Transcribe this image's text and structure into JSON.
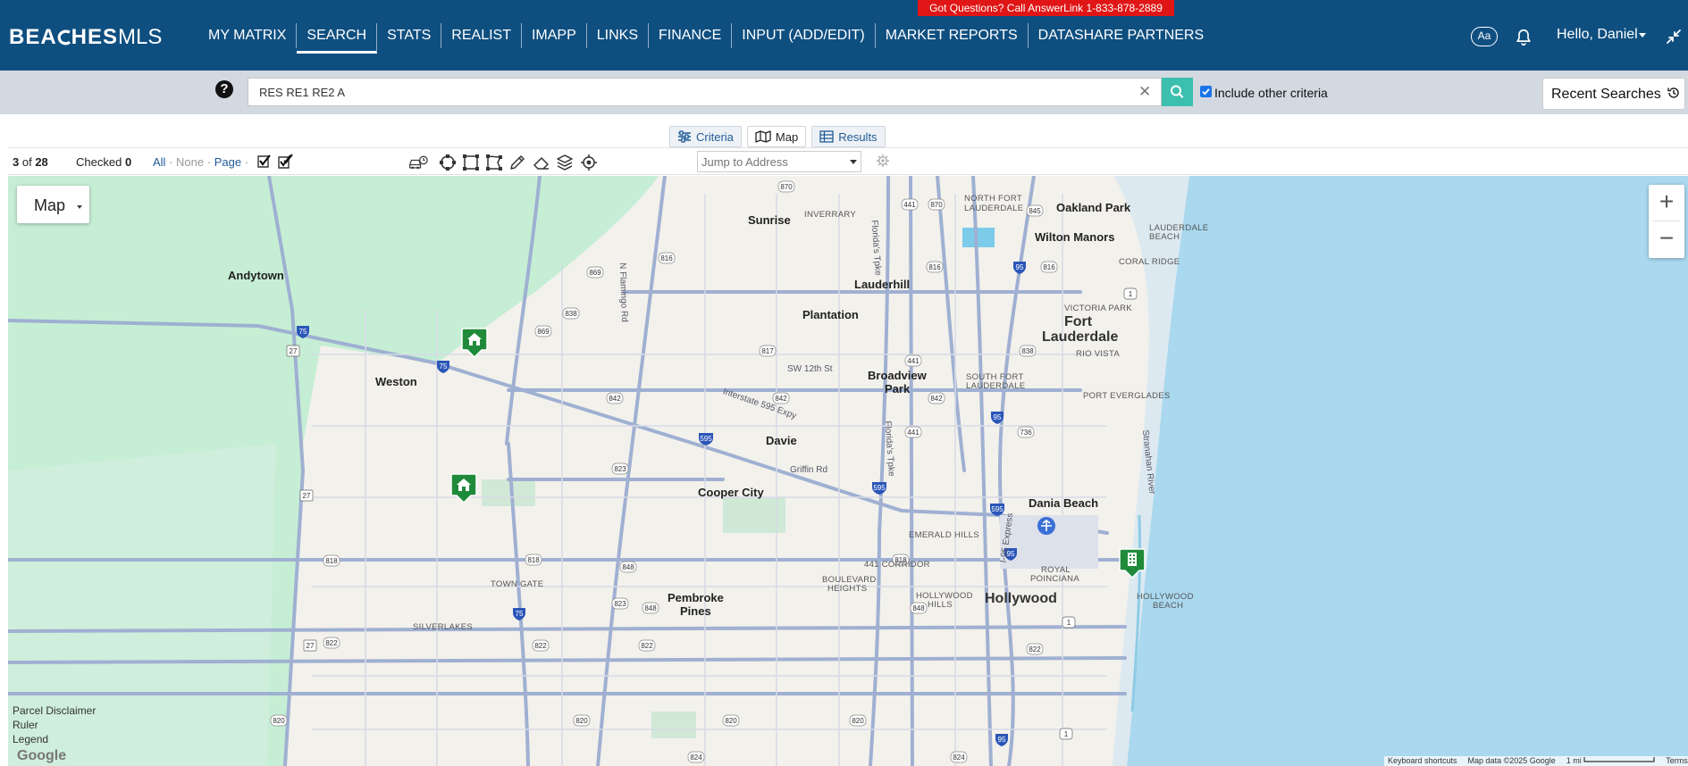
{
  "brand": {
    "logo_text": "BEACHESMLS"
  },
  "promo_banner": "Got Questions? Call AnswerLink 1-833-878-2889",
  "nav": {
    "items": [
      {
        "label": "MY MATRIX",
        "active": false
      },
      {
        "label": "SEARCH",
        "active": true
      },
      {
        "label": "STATS",
        "active": false
      },
      {
        "label": "REALIST",
        "active": false
      },
      {
        "label": "IMAPP",
        "active": false
      },
      {
        "label": "LINKS",
        "active": false
      },
      {
        "label": "FINANCE",
        "active": false
      },
      {
        "label": "INPUT (ADD/EDIT)",
        "active": false
      },
      {
        "label": "MARKET REPORTS",
        "active": false
      },
      {
        "label": "DATASHARE PARTNERS",
        "active": false
      }
    ],
    "font_toggle": "Aa",
    "greeting": "Hello, Daniel"
  },
  "search": {
    "value": "RES RE1 RE2 A",
    "include_other_criteria": true,
    "include_label": "Include other criteria",
    "recent_label": "Recent Searches"
  },
  "tabs": [
    {
      "label": "Criteria",
      "icon": "sliders-icon",
      "active": false
    },
    {
      "label": "Map",
      "icon": "map-icon",
      "active": true
    },
    {
      "label": "Results",
      "icon": "table-icon",
      "active": false
    }
  ],
  "toolbar": {
    "current": "3",
    "of_word": "of",
    "total": "28",
    "checked_label": "Checked",
    "checked_count": "0",
    "select_all": "All",
    "select_none": "None",
    "select_page": "Page",
    "jump_placeholder": "Jump to Address"
  },
  "map": {
    "type_label": "Map",
    "corner_links": [
      "Parcel Disclaimer",
      "Ruler",
      "Legend"
    ],
    "google_label": "Google",
    "attribution": [
      "Keyboard shortcuts",
      "Map data ©2025 Google",
      "1 mi",
      "Terms"
    ],
    "colors": {
      "water": "#a9d8ef",
      "land": "#f3f1ec",
      "park": "#c6eed5",
      "road": "#9fb0d2",
      "marker": "#1f8b3a"
    },
    "places": [
      {
        "name": "Andytown",
        "kind": "city"
      },
      {
        "name": "Weston",
        "kind": "city"
      },
      {
        "name": "Sunrise",
        "kind": "city"
      },
      {
        "name": "Plantation",
        "kind": "city"
      },
      {
        "name": "Lauderhill",
        "kind": "city"
      },
      {
        "name": "INVERRARY",
        "kind": "area"
      },
      {
        "name": "NORTH FORT",
        "kind": "area"
      },
      {
        "name": "LAUDERDALE",
        "kind": "area"
      },
      {
        "name": "Oakland Park",
        "kind": "city"
      },
      {
        "name": "Wilton Manors",
        "kind": "city"
      },
      {
        "name": "LAUDERDALE",
        "kind": "area"
      },
      {
        "name": "BEACH",
        "kind": "area"
      },
      {
        "name": "CORAL RIDGE",
        "kind": "area"
      },
      {
        "name": "VICTORIA PARK",
        "kind": "area"
      },
      {
        "name": "Fort",
        "kind": "major"
      },
      {
        "name": "Lauderdale",
        "kind": "major"
      },
      {
        "name": "RIO VISTA",
        "kind": "area"
      },
      {
        "name": "PORT EVERGLADES",
        "kind": "area"
      },
      {
        "name": "SW 12th St",
        "kind": "road"
      },
      {
        "name": "Broadview",
        "kind": "city"
      },
      {
        "name": "Park",
        "kind": "city"
      },
      {
        "name": "SOUTH FORT",
        "kind": "area"
      },
      {
        "name": "LAUDERDALE",
        "kind": "area"
      },
      {
        "name": "Davie",
        "kind": "city"
      },
      {
        "name": "Griffin Rd",
        "kind": "road"
      },
      {
        "name": "Cooper City",
        "kind": "city"
      },
      {
        "name": "Dania Beach",
        "kind": "city"
      },
      {
        "name": "EMERALD HILLS",
        "kind": "area"
      },
      {
        "name": "441 CORRIDOR",
        "kind": "area"
      },
      {
        "name": "ROYAL",
        "kind": "area"
      },
      {
        "name": "POINCIANA",
        "kind": "area"
      },
      {
        "name": "BOULEVARD",
        "kind": "area"
      },
      {
        "name": "HEIGHTS",
        "kind": "area"
      },
      {
        "name": "HOLLYWOOD",
        "kind": "area"
      },
      {
        "name": "HILLS",
        "kind": "area"
      },
      {
        "name": "Hollywood",
        "kind": "major"
      },
      {
        "name": "HOLLYWOOD",
        "kind": "area"
      },
      {
        "name": "BEACH",
        "kind": "area"
      },
      {
        "name": "TOWN GATE",
        "kind": "area"
      },
      {
        "name": "Pembroke",
        "kind": "city"
      },
      {
        "name": "Pines",
        "kind": "city"
      },
      {
        "name": "SILVERLAKES",
        "kind": "area"
      },
      {
        "name": "Interstate 595 Expy",
        "kind": "road"
      },
      {
        "name": "N Flamingo Rd",
        "kind": "road"
      },
      {
        "name": "Florida's Tpke",
        "kind": "road"
      },
      {
        "name": "Florida's Tpke",
        "kind": "road"
      },
      {
        "name": "I-95 Express",
        "kind": "road"
      },
      {
        "name": "Stranahan River",
        "kind": "road"
      }
    ],
    "shields": [
      "870",
      "441",
      "870",
      "845",
      "816",
      "816",
      "95",
      "816",
      "869",
      "838",
      "869",
      "75",
      "27",
      "75",
      "817",
      "441",
      "842",
      "838",
      "842",
      "95",
      "736",
      "441",
      "595",
      "823",
      "595",
      "595",
      "27",
      "817",
      "95",
      "818",
      "818",
      "848",
      "823",
      "75",
      "848",
      "822",
      "27",
      "822",
      "822",
      "95",
      "822",
      "1",
      "1",
      "820",
      "820",
      "820",
      "95",
      "824",
      "824",
      "824"
    ]
  }
}
